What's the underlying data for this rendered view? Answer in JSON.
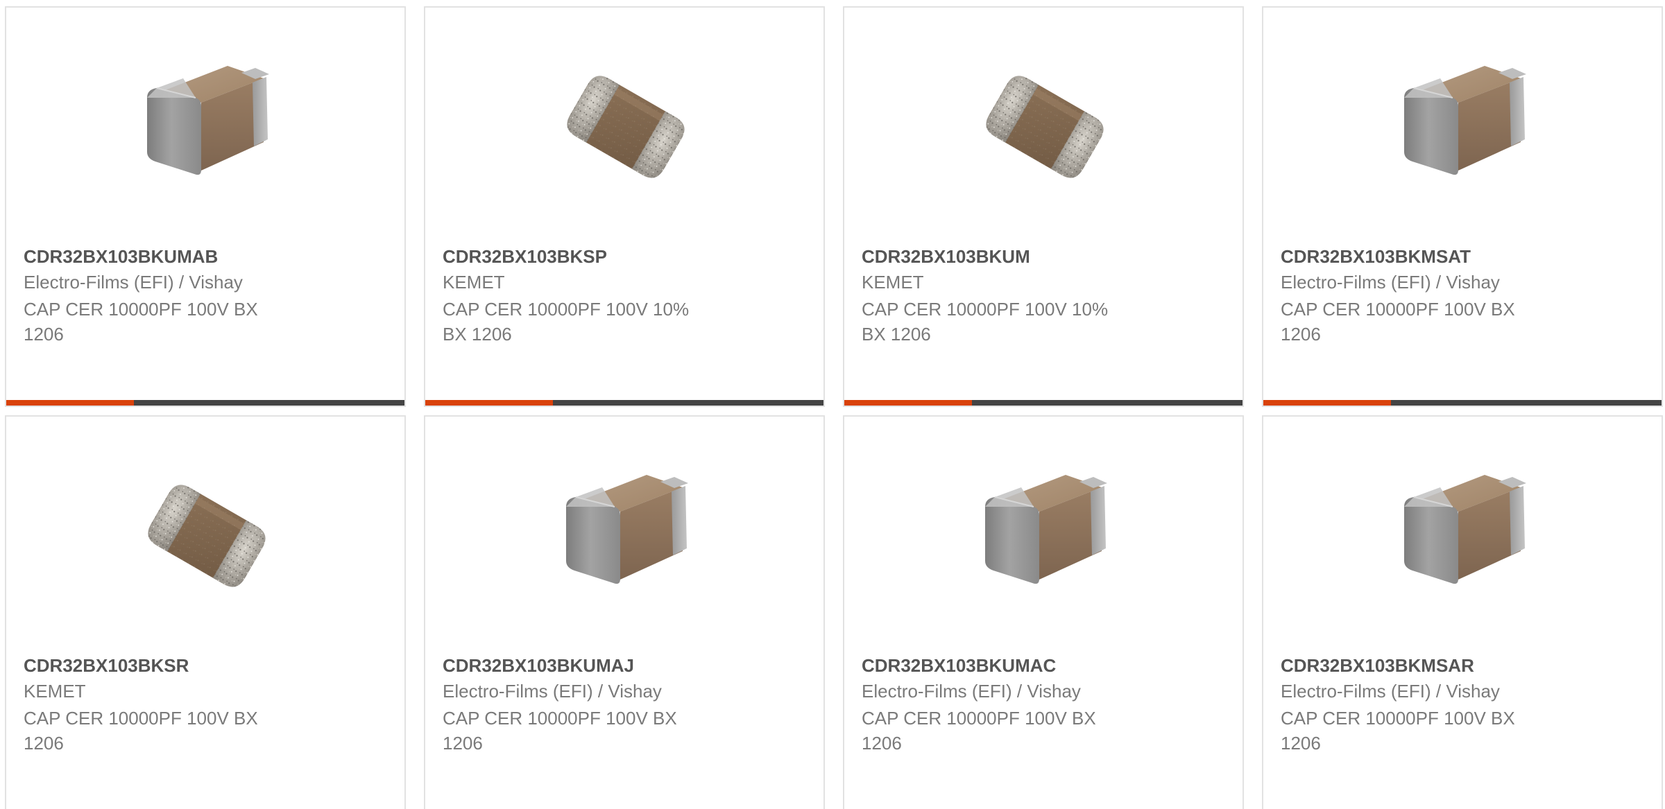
{
  "colors": {
    "accent": "#d9420b",
    "bar_track": "#444444",
    "card_border": "#e2e2e2",
    "part_number_text": "#555555",
    "body_text": "#7a7a7a"
  },
  "products": [
    {
      "part_number": "CDR32BX103BKUMAB",
      "manufacturer": "Electro-Films (EFI) / Vishay",
      "description_line1": "CAP CER 10000PF 100V BX",
      "description_line2": "1206",
      "image": "capacitor-chip-smooth-icon",
      "bar_progress": 0.32
    },
    {
      "part_number": "CDR32BX103BKSP",
      "manufacturer": "KEMET",
      "description_line1": "CAP CER 10000PF 100V 10%",
      "description_line2": "BX 1206",
      "image": "capacitor-chip-textured-icon",
      "bar_progress": 0.32
    },
    {
      "part_number": "CDR32BX103BKUM",
      "manufacturer": "KEMET",
      "description_line1": "CAP CER 10000PF 100V 10%",
      "description_line2": "BX 1206",
      "image": "capacitor-chip-textured-icon",
      "bar_progress": 0.32
    },
    {
      "part_number": "CDR32BX103BKMSAT",
      "manufacturer": "Electro-Films (EFI) / Vishay",
      "description_line1": "CAP CER 10000PF 100V BX",
      "description_line2": "1206",
      "image": "capacitor-chip-smooth-icon",
      "bar_progress": 0.32
    },
    {
      "part_number": "CDR32BX103BKSR",
      "manufacturer": "KEMET",
      "description_line1": "CAP CER 10000PF 100V BX",
      "description_line2": "1206",
      "image": "capacitor-chip-textured-icon",
      "bar_progress": 0.32
    },
    {
      "part_number": "CDR32BX103BKUMAJ",
      "manufacturer": "Electro-Films (EFI) / Vishay",
      "description_line1": "CAP CER 10000PF 100V BX",
      "description_line2": "1206",
      "image": "capacitor-chip-smooth-icon",
      "bar_progress": 0.32
    },
    {
      "part_number": "CDR32BX103BKUMAC",
      "manufacturer": "Electro-Films (EFI) / Vishay",
      "description_line1": "CAP CER 10000PF 100V BX",
      "description_line2": "1206",
      "image": "capacitor-chip-smooth-icon",
      "bar_progress": 0.32
    },
    {
      "part_number": "CDR32BX103BKMSAR",
      "manufacturer": "Electro-Films (EFI) / Vishay",
      "description_line1": "CAP CER 10000PF 100V BX",
      "description_line2": "1206",
      "image": "capacitor-chip-smooth-icon",
      "bar_progress": 0.32
    }
  ]
}
